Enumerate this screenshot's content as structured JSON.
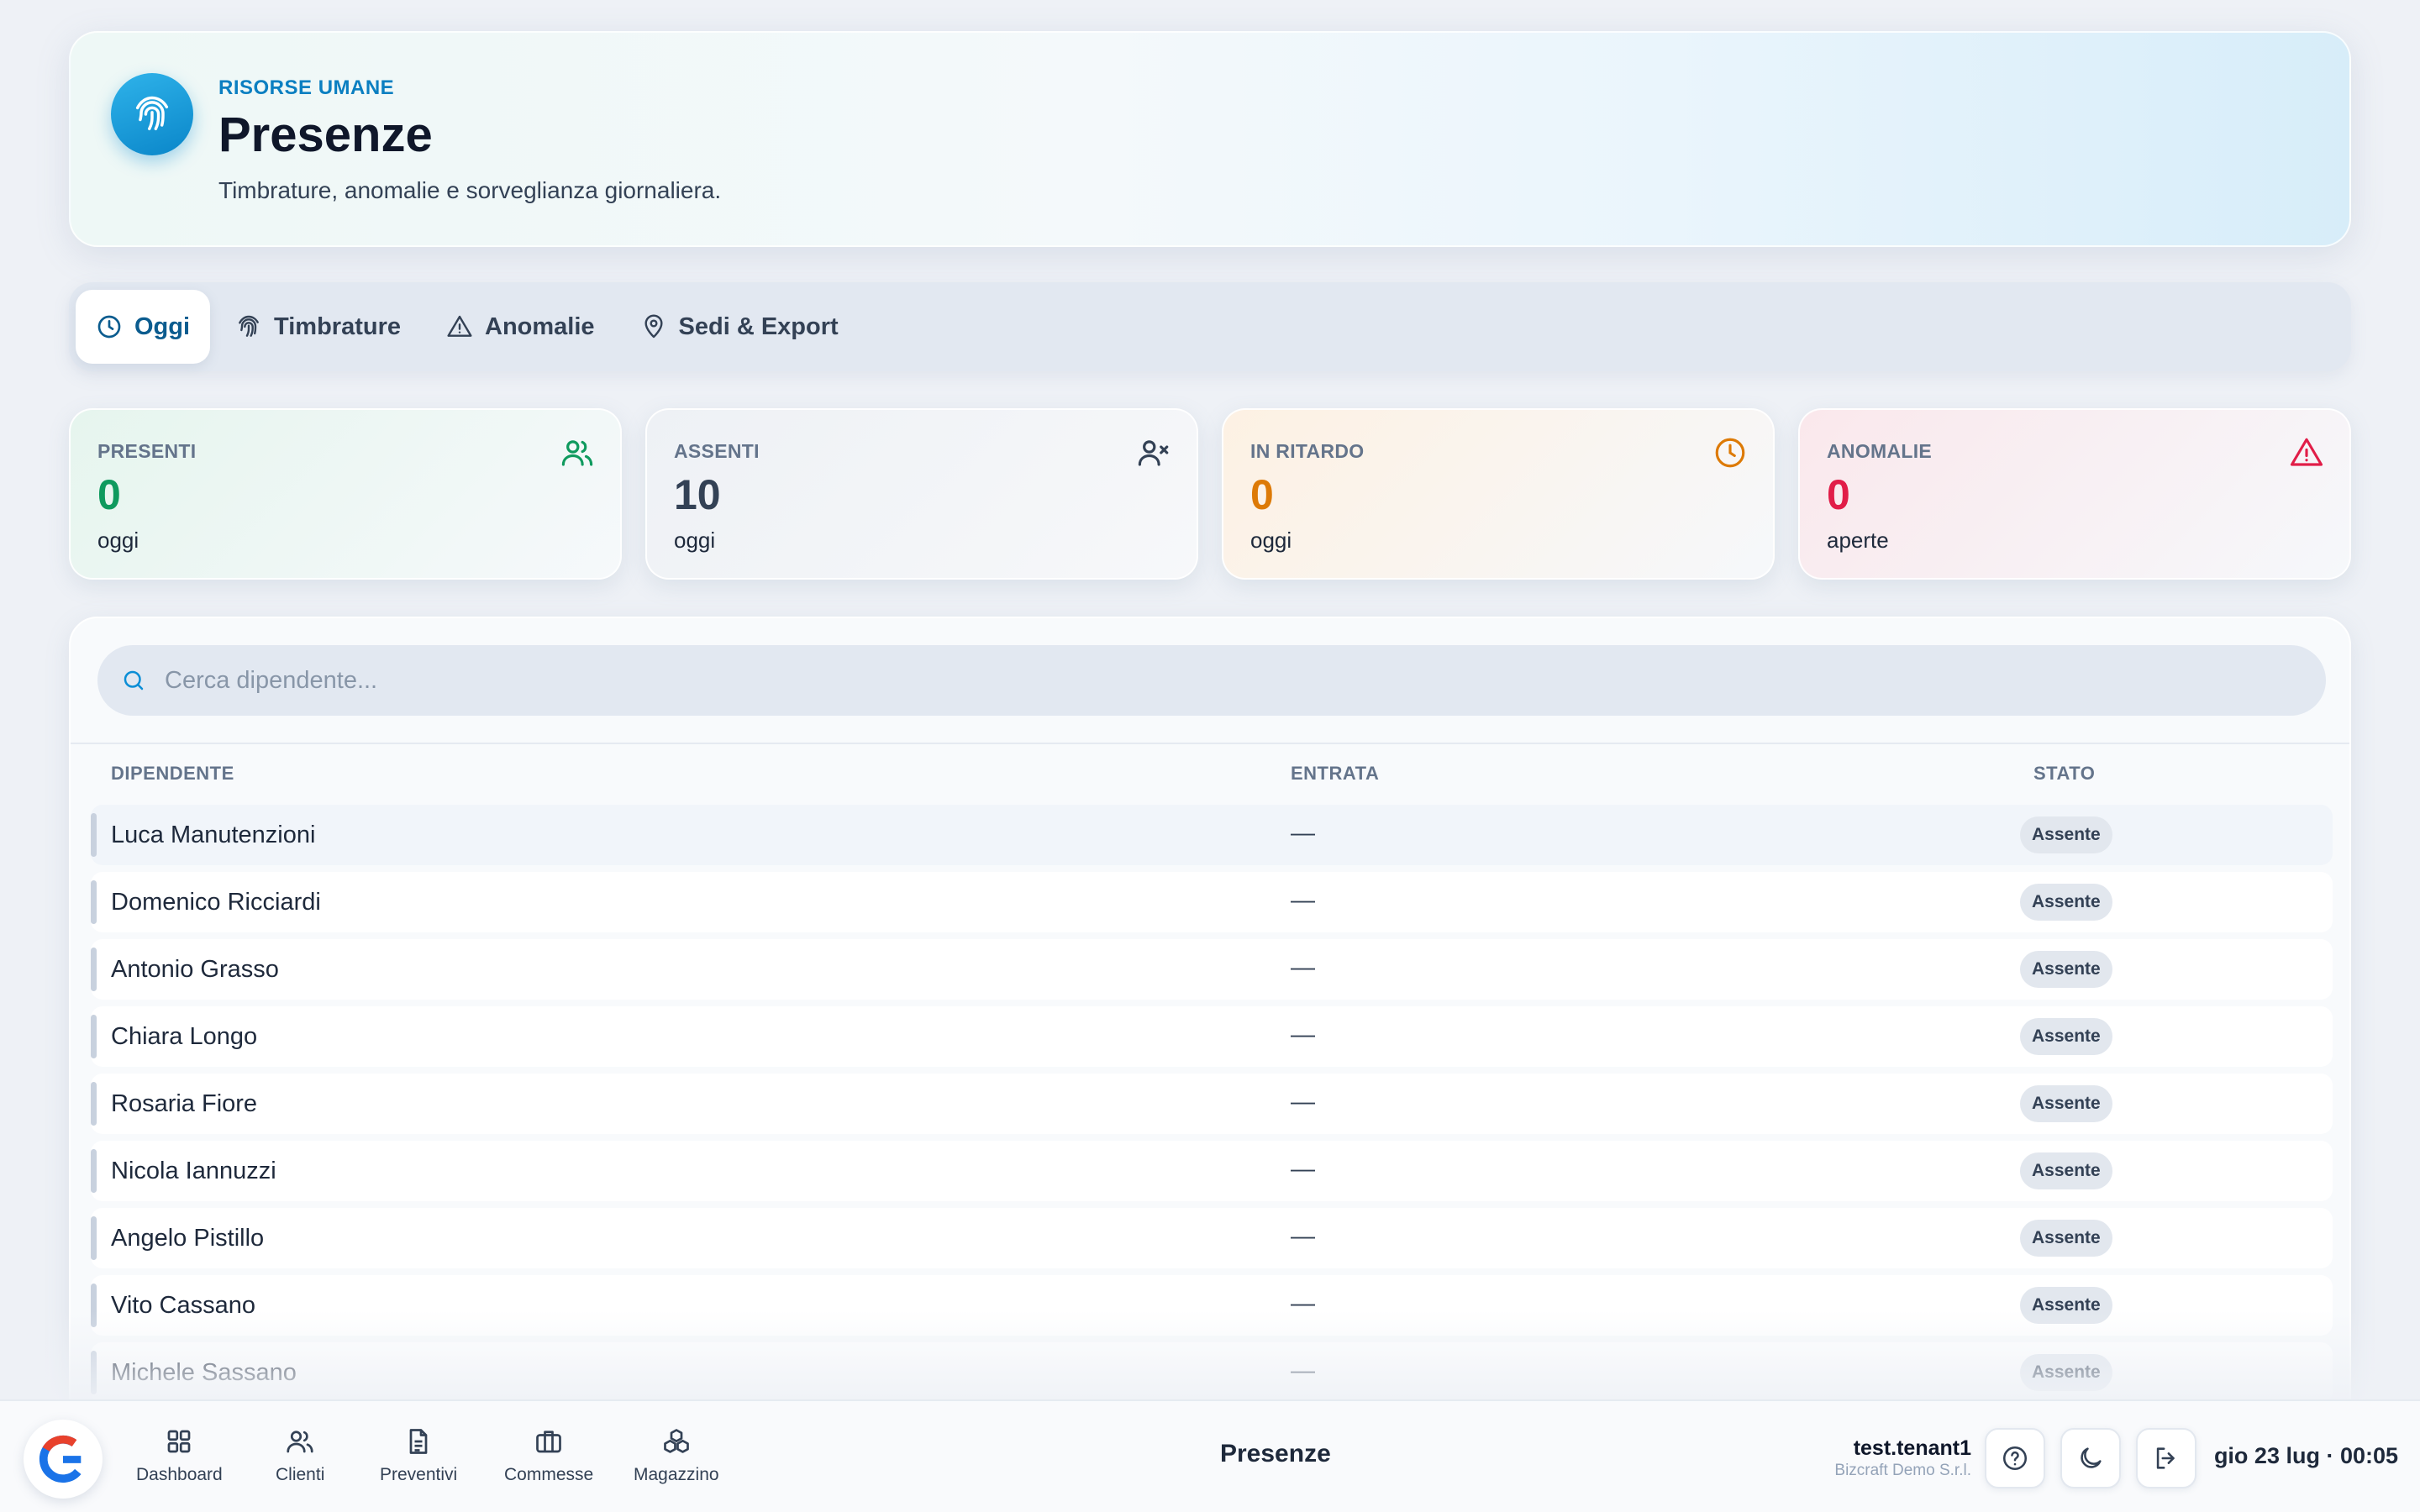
{
  "header": {
    "eyebrow": "RISORSE UMANE",
    "title": "Presenze",
    "subtitle": "Timbrature, anomalie e sorveglianza giornaliera.",
    "icon": "fingerprint-icon"
  },
  "tabs": [
    {
      "label": "Oggi",
      "icon": "clock-icon",
      "active": true
    },
    {
      "label": "Timbrature",
      "icon": "fingerprint-icon",
      "active": false
    },
    {
      "label": "Anomalie",
      "icon": "warning-icon",
      "active": false
    },
    {
      "label": "Sedi & Export",
      "icon": "map-pin-icon",
      "active": false
    }
  ],
  "stats": {
    "presenti": {
      "label": "PRESENTI",
      "value": "0",
      "sub": "oggi",
      "color": "#0f9a5e",
      "icon": "users-icon"
    },
    "assenti": {
      "label": "ASSENTI",
      "value": "10",
      "sub": "oggi",
      "color": "#334155",
      "icon": "user-x-icon"
    },
    "ritardo": {
      "label": "IN RITARDO",
      "value": "0",
      "sub": "oggi",
      "color": "#dd7a06",
      "icon": "clock-icon"
    },
    "anomalie": {
      "label": "ANOMALIE",
      "value": "0",
      "sub": "aperte",
      "color": "#e11d48",
      "icon": "warning-icon"
    }
  },
  "search": {
    "placeholder": "Cerca dipendente..."
  },
  "table": {
    "columns": [
      "DIPENDENTE",
      "ENTRATA",
      "STATO"
    ],
    "rows": [
      {
        "name": "Luca Manutenzioni",
        "entry": "—",
        "status": "Assente"
      },
      {
        "name": "Domenico Ricciardi",
        "entry": "—",
        "status": "Assente"
      },
      {
        "name": "Antonio Grasso",
        "entry": "—",
        "status": "Assente"
      },
      {
        "name": "Chiara Longo",
        "entry": "—",
        "status": "Assente"
      },
      {
        "name": "Rosaria Fiore",
        "entry": "—",
        "status": "Assente"
      },
      {
        "name": "Nicola Iannuzzi",
        "entry": "—",
        "status": "Assente"
      },
      {
        "name": "Angelo Pistillo",
        "entry": "—",
        "status": "Assente"
      },
      {
        "name": "Vito Cassano",
        "entry": "—",
        "status": "Assente"
      },
      {
        "name": "Michele Sassano",
        "entry": "—",
        "status": "Assente"
      }
    ]
  },
  "bottombar": {
    "nav": [
      {
        "label": "Dashboard",
        "icon": "grid-icon"
      },
      {
        "label": "Clienti",
        "icon": "users-icon"
      },
      {
        "label": "Preventivi",
        "icon": "document-icon"
      },
      {
        "label": "Commesse",
        "icon": "briefcase-icon"
      },
      {
        "label": "Magazzino",
        "icon": "boxes-icon"
      }
    ],
    "title": "Presenze",
    "user": "test.tenant1",
    "company": "Bizcraft Demo S.r.l.",
    "datetime": "gio 23 lug · 00:05"
  },
  "colors": {
    "accent": "#0b7fc1",
    "brand_red": "#e8412c",
    "brand_blue": "#1a73e8"
  }
}
